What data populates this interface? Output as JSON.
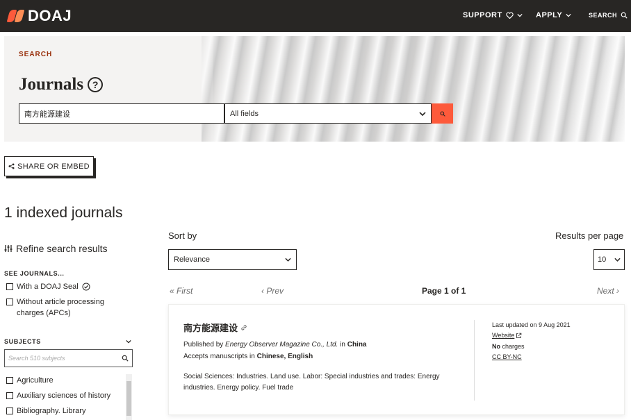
{
  "navbar": {
    "logo_text": "DOAJ",
    "support_label": "SUPPORT",
    "apply_label": "APPLY",
    "search_label": "SEARCH"
  },
  "hero": {
    "label": "SEARCH",
    "title": "Journals",
    "search_value": "南方能源建设",
    "field_select_value": "All fields"
  },
  "share_label": "SHARE OR EMBED",
  "results_count": "1 indexed journals",
  "sidebar": {
    "refine_title": "Refine search results",
    "see_journals_heading": "SEE JOURNALS...",
    "see_journals_items": [
      "With a DOAJ Seal",
      "Without article processing charges (APCs)"
    ],
    "subjects_heading": "SUBJECTS",
    "subjects_placeholder": "Search 510 subjects",
    "subjects": [
      "Agriculture",
      "Auxiliary sciences of history",
      "Bibliography. Library"
    ]
  },
  "controls": {
    "sort_label": "Sort by",
    "sort_value": "Relevance",
    "rpp_label": "Results per page",
    "rpp_value": "10"
  },
  "pagination": {
    "first": "First",
    "prev": "Prev",
    "page": "Page 1 of 1",
    "next": "Next"
  },
  "result": {
    "title": "南方能源建设",
    "published_by_prefix": "Published by",
    "publisher": "Energy Observer Magazine Co., Ltd.",
    "in_word": "in",
    "country": "China",
    "accepts_prefix": "Accepts manuscripts in",
    "languages": "Chinese, English",
    "subjects_text": "Social Sciences: Industries. Land use. Labor: Special industries and trades: Energy industries. Energy policy. Fuel trade",
    "last_updated": "Last updated on 9 Aug 2021",
    "website_label": "Website",
    "charges_bold": "No",
    "charges_rest": "charges",
    "license": "CC BY-NC"
  },
  "colors": {
    "navbar_bg": "#282624",
    "accent": "#fd5a3b",
    "label_red": "#982e0a"
  }
}
